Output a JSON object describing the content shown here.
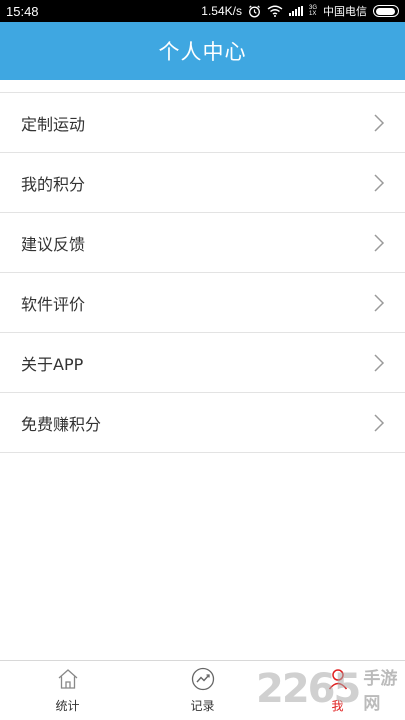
{
  "status_bar": {
    "time": "15:48",
    "speed": "1.54K/s",
    "net_top": "3G",
    "net_bottom": "1X",
    "carrier": "中国电信",
    "battery_level": 0.95
  },
  "header": {
    "title": "个人中心"
  },
  "menu": {
    "items": [
      {
        "label": "定制运动"
      },
      {
        "label": "我的积分"
      },
      {
        "label": "建议反馈"
      },
      {
        "label": "软件评价"
      },
      {
        "label": "关于APP"
      },
      {
        "label": "免费赚积分"
      }
    ]
  },
  "tabbar": {
    "tabs": [
      {
        "label": "统计",
        "icon": "home-icon"
      },
      {
        "label": "记录",
        "icon": "trend-chart-icon"
      },
      {
        "label": "我",
        "icon": "person-icon",
        "active": true
      }
    ]
  },
  "watermark": {
    "number": "2265",
    "site": "手游网"
  },
  "colors": {
    "header_bg": "#3fa7e1",
    "active_tab": "#e02020"
  }
}
